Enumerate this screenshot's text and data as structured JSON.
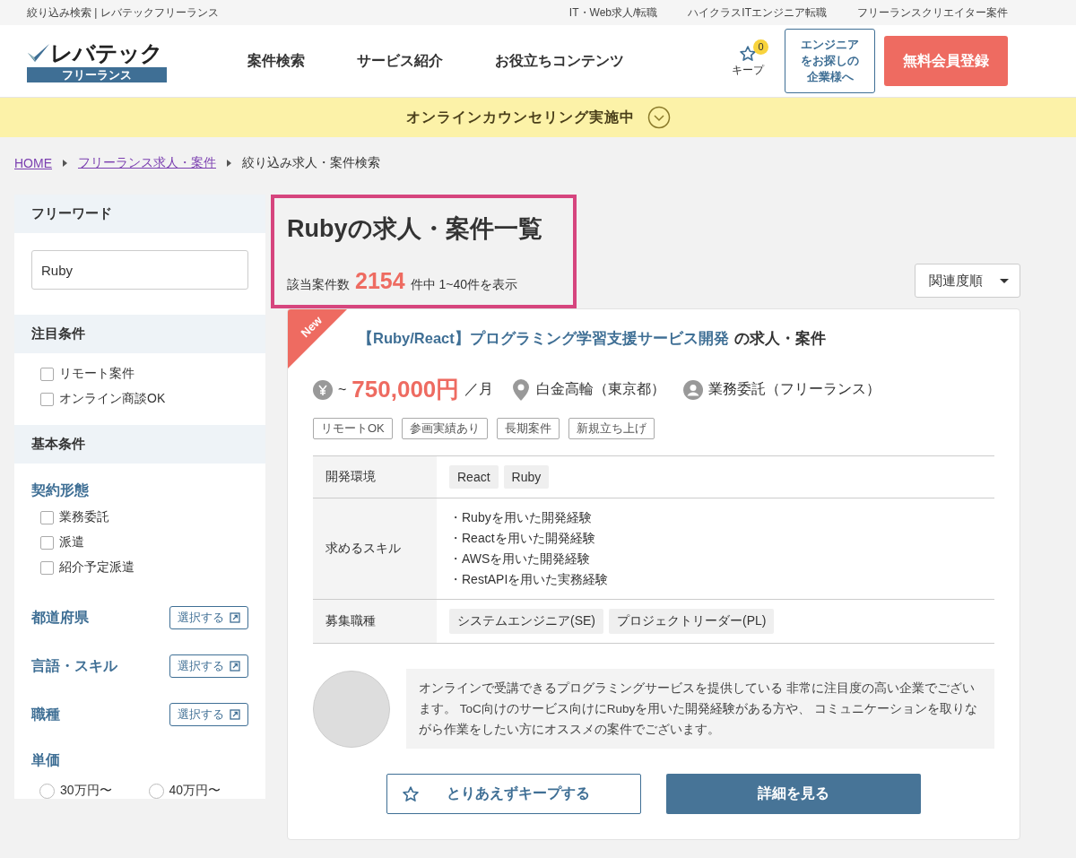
{
  "topbar": {
    "title": "絞り込み検索 | レバテックフリーランス",
    "links": [
      "IT・Web求人/転職",
      "ハイクラスITエンジニア転職",
      "フリーランスクリエイター案件"
    ]
  },
  "header": {
    "logo_text": "レバテック",
    "logo_sub": "フリーランス",
    "nav": [
      "案件検索",
      "サービス紹介",
      "お役立ちコンテンツ"
    ],
    "keep_label": "キープ",
    "keep_count": "0",
    "company_button": "エンジニアをお探しの企業様へ",
    "signup_button": "無料会員登録"
  },
  "banner": {
    "text": "オンラインカウンセリング実施中"
  },
  "breadcrumb": [
    {
      "label": "HOME",
      "link": true
    },
    {
      "label": "フリーランス求人・案件",
      "link": true
    },
    {
      "label": "絞り込み求人・案件検索",
      "link": false
    }
  ],
  "sidebar": {
    "freeword_heading": "フリーワード",
    "freeword_value": "Ruby",
    "featured_heading": "注目条件",
    "featured": [
      {
        "label": "リモート案件",
        "checked": false
      },
      {
        "label": "オンライン商談OK",
        "checked": false
      }
    ],
    "basic_heading": "基本条件",
    "contract_heading": "契約形態",
    "contract": [
      {
        "label": "業務委託",
        "checked": false
      },
      {
        "label": "派遣",
        "checked": false
      },
      {
        "label": "紹介予定派遣",
        "checked": false
      }
    ],
    "selectors": [
      {
        "label": "都道府県",
        "button": "選択する"
      },
      {
        "label": "言語・スキル",
        "button": "選択する"
      },
      {
        "label": "職種",
        "button": "選択する"
      }
    ],
    "price_heading": "単価",
    "prices": [
      {
        "label": "30万円〜",
        "selected": false
      },
      {
        "label": "40万円〜",
        "selected": false
      }
    ]
  },
  "results": {
    "title_keyword": "Ruby",
    "title_rest": "の求人・案件一覧",
    "count_label": "該当案件数",
    "count": "2154",
    "count_suffix": "件中 1~40件を表示",
    "sort": "関連度順"
  },
  "job": {
    "badge": "New",
    "title_link": "【Ruby/React】プログラミング学習支援サービス開発",
    "title_suffix": "の求人・案件",
    "price_prefix": "~",
    "price": "750,000円",
    "price_unit": "／月",
    "location": "白金高輪（東京都）",
    "contract": "業務委託（フリーランス）",
    "tags": [
      "リモートOK",
      "参画実績あり",
      "長期案件",
      "新規立ち上げ"
    ],
    "details": [
      {
        "label": "開発環境",
        "kind": "chips",
        "values": [
          "React",
          "Ruby"
        ]
      },
      {
        "label": "求めるスキル",
        "kind": "list",
        "values": [
          "・Rubyを用いた開発経験",
          "・Reactを用いた開発経験",
          "・AWSを用いた開発経験",
          "・RestAPIを用いた実務経験"
        ]
      },
      {
        "label": "募集職種",
        "kind": "chips",
        "values": [
          "システムエンジニア(SE)",
          "プロジェクトリーダー(PL)"
        ]
      }
    ],
    "comment": "オンラインで受講できるプログラミングサービスを提供している 非常に注目度の高い企業でございます。 ToC向けのサービス向けにRubyを用いた開発経験がある方や、 コミュニケーションを取りながら作業をしたい方にオススメの案件でございます。",
    "keep_button": "とりあえずキープする",
    "detail_button": "詳細を見る"
  }
}
